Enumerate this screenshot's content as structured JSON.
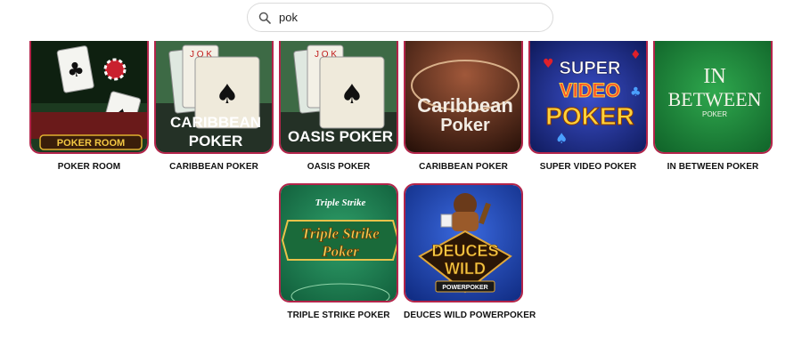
{
  "search": {
    "value": "pok",
    "icon": "search-icon"
  },
  "games": [
    {
      "title": "POKER ROOM",
      "art_text": "POKER ROOM",
      "bg": "#1f3a22"
    },
    {
      "title": "CARIBBEAN POKER",
      "art_text_1": "CARIBBEAN",
      "art_text_2": "POKER",
      "bg": "#2f5a3a"
    },
    {
      "title": "OASIS POKER",
      "art_text": "OASIS POKER",
      "bg": "#2f5a3a"
    },
    {
      "title": "CARIBBEAN POKER",
      "art_text_1": "Caribbean",
      "art_text_2": "Poker",
      "bg": "#5a2e1e"
    },
    {
      "title": "SUPER VIDEO POKER",
      "art_text_1": "SUPER",
      "art_text_2": "VIDEO",
      "art_text_3": "POKER",
      "bg": "#1b2f8a"
    },
    {
      "title": "IN BETWEEN POKER",
      "art_text_1": "IN",
      "art_text_2": "BETWEEN",
      "art_text_3": "POKER",
      "bg": "#1f7a3a"
    },
    {
      "title": "TRIPLE STRIKE POKER",
      "art_text_1": "Triple Strike",
      "art_text_2": "Triple Strike",
      "art_text_3": "Poker",
      "bg": "#1f7a4e"
    },
    {
      "title": "DEUCES WILD POWERPOKER",
      "art_text_1": "DEUCES",
      "art_text_2": "WILD",
      "art_text_3": "POWERPOKER",
      "bg": "#1d3a9a"
    }
  ],
  "colors": {
    "accent": "#b3244a"
  }
}
